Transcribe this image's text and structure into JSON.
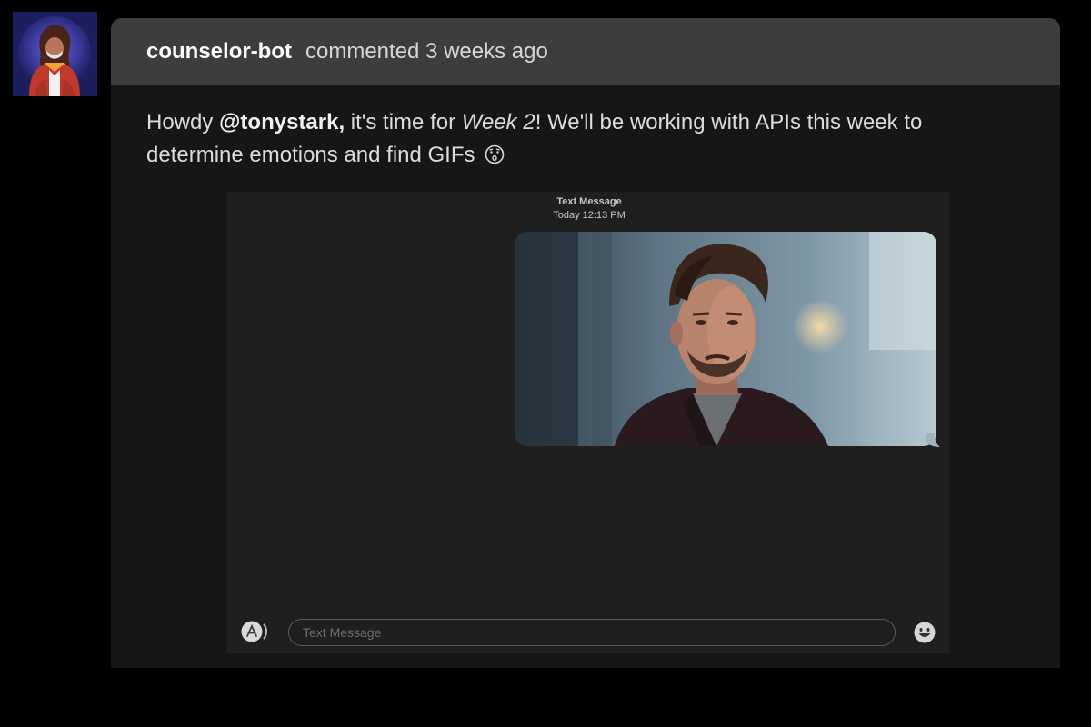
{
  "comment": {
    "author": "counselor-bot",
    "meta": "commented 3 weeks ago",
    "body": {
      "greeting": "Howdy ",
      "mention": "@tonystark,",
      "text_before_week": " it's time for ",
      "week": "Week 2",
      "text_after_week": "! We'll be working with APIs this week to determine emotions and find GIFs",
      "emoji": "face-with-open-mouth-emoji"
    }
  },
  "messages": {
    "service": "Text Message",
    "timestamp": "Today 12:13 PM",
    "input_placeholder": "Text Message",
    "apps_icon": "app-store-icon",
    "emoji_icon": "smiley-emoji-icon"
  },
  "colors": {
    "page_background": "#000000",
    "card_header": "#3d3d3d",
    "card_body": "#161616",
    "messages_background": "#1f1f1f",
    "avatar_background": "#1c1f5e"
  }
}
